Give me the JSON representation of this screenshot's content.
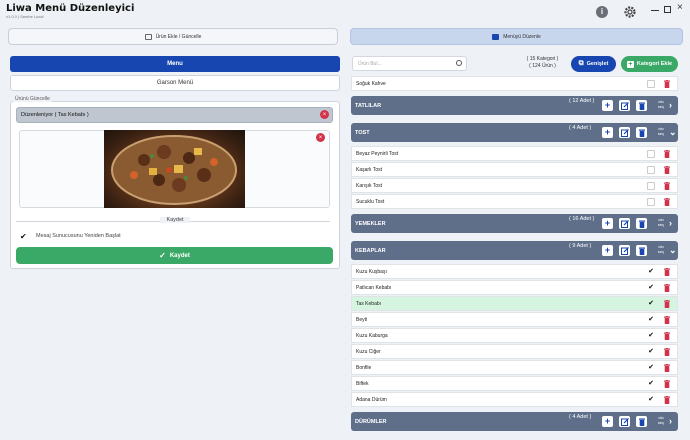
{
  "app": {
    "title": "Liwa Menü Düzenleyici",
    "subtitle": "v1.0.0 | Sembe Local"
  },
  "tabs": [
    {
      "label": "Ürün Ekle / Güncelle"
    },
    {
      "label": "Menüyü Düzenle"
    }
  ],
  "left": {
    "menu_button": "Menu",
    "garson_button": "Garson Menü",
    "edit_legend": "Ürünü Güncelle",
    "edit_value": "Düzenleniyor ( Tas Kebabı )",
    "save_section": "Kaydet",
    "checkbox_label": "Mesaj Sunucusunu Yeniden Başlat",
    "save_button": "Kaydet"
  },
  "right": {
    "search_placeholder": "Ürün Bul...",
    "category_count": "( 15 Kategori )",
    "product_count": "( 124 Ürün )",
    "expand_button": "Genişlet",
    "add_category_button": "Kategori Ekle",
    "auto_label": "oto seç"
  },
  "list": [
    {
      "kind": "item",
      "name": "Soğuk Kahve",
      "checked": false
    },
    {
      "kind": "cat",
      "name": "TATLILAR",
      "count": "( 12 Adet )",
      "open": false
    },
    {
      "kind": "cat",
      "name": "TOST",
      "count": "( 4 Adet )",
      "open": true
    },
    {
      "kind": "item",
      "name": "Beyaz Peynirli Tost",
      "checked": false
    },
    {
      "kind": "item",
      "name": "Kaşarlı Tost",
      "checked": false
    },
    {
      "kind": "item",
      "name": "Karışık Tost",
      "checked": false
    },
    {
      "kind": "item",
      "name": "Sucuklu Tost",
      "checked": false
    },
    {
      "kind": "cat",
      "name": "YEMEKLER",
      "count": "( 16 Adet )",
      "open": false
    },
    {
      "kind": "cat",
      "name": "KEBAPLAR",
      "count": "( 9 Adet )",
      "open": true
    },
    {
      "kind": "item",
      "name": "Kuzu Kuşbaşı",
      "checked": true
    },
    {
      "kind": "item",
      "name": "Patlıcan Kebabı",
      "checked": true
    },
    {
      "kind": "item",
      "name": "Tas Kebabı",
      "checked": true,
      "selected": true
    },
    {
      "kind": "item",
      "name": "Beyti",
      "checked": true
    },
    {
      "kind": "item",
      "name": "Kuzu Kaburga",
      "checked": true
    },
    {
      "kind": "item",
      "name": "Kuzu Ciğer",
      "checked": true
    },
    {
      "kind": "item",
      "name": "Bonfile",
      "checked": true
    },
    {
      "kind": "item",
      "name": "Biftek",
      "checked": true
    },
    {
      "kind": "item",
      "name": "Adana Dürüm",
      "checked": true
    },
    {
      "kind": "cat",
      "name": "DÜRÜMLER",
      "count": "( 4 Adet )",
      "open": false
    }
  ],
  "colors": {
    "primary": "#1746b0",
    "success": "#3aa866",
    "danger": "#d2334a",
    "category_bg": "#5f6f8a",
    "selected_row": "#d5f5e0"
  }
}
